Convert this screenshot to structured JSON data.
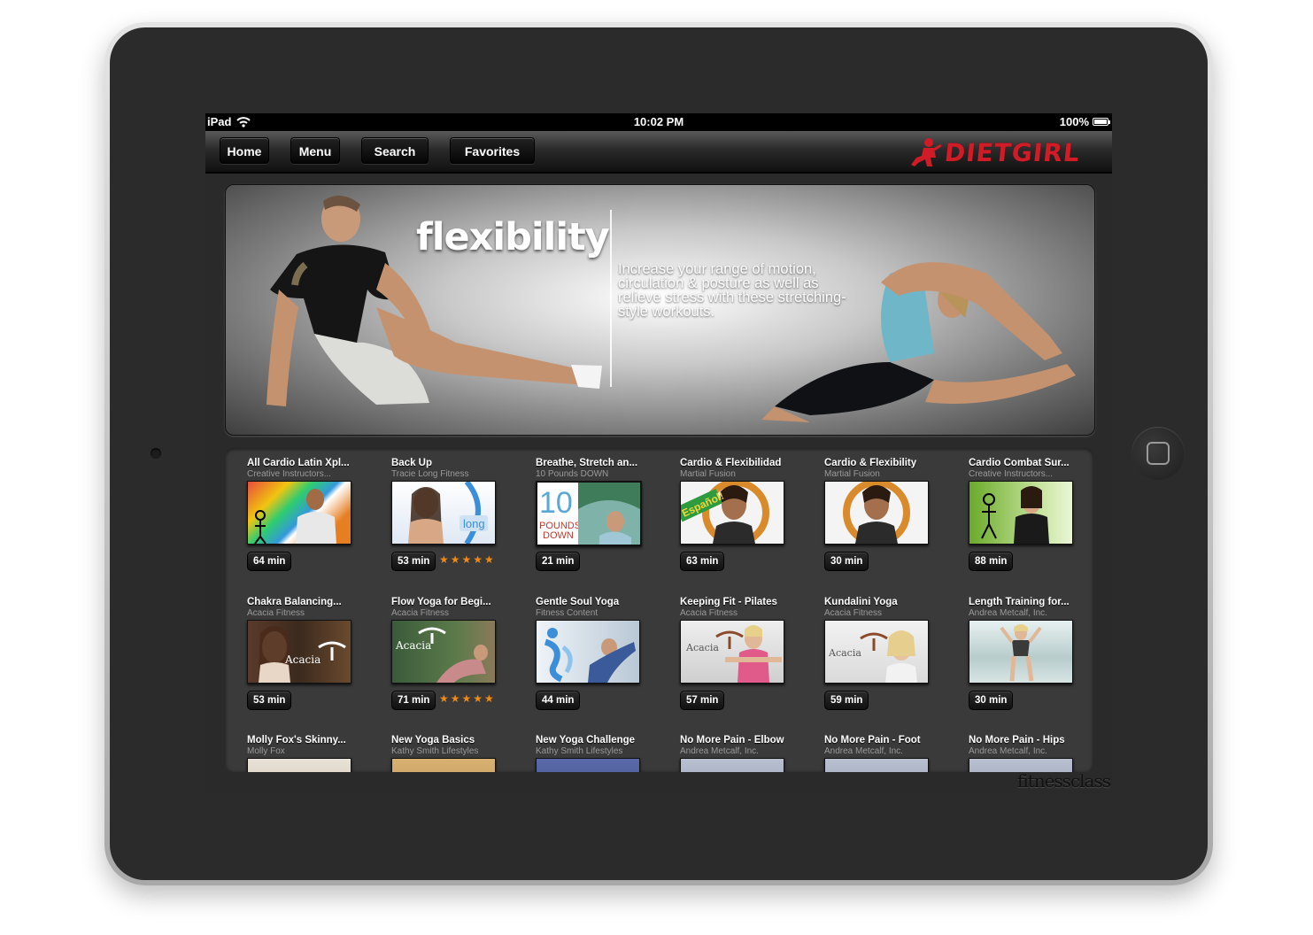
{
  "status_bar": {
    "device": "iPad",
    "time": "10:02 PM",
    "battery": "100%"
  },
  "nav": {
    "buttons": [
      "Home",
      "Menu",
      "Search",
      "Favorites"
    ],
    "logo": "DIETGIRL"
  },
  "hero": {
    "title": "flexibility",
    "description": "Increase your range of motion, circulation & posture as well as relieve stress with these stretching-style workouts."
  },
  "workouts": [
    {
      "title": "All Cardio Latin Xpl...",
      "author": "Creative Instructors...",
      "duration": "64 min",
      "rating": 0
    },
    {
      "title": "Back Up",
      "author": "Tracie Long Fitness",
      "duration": "53 min",
      "rating": 5
    },
    {
      "title": "Breathe, Stretch an...",
      "author": "10 Pounds DOWN",
      "duration": "21 min",
      "rating": 0
    },
    {
      "title": "Cardio & Flexibilidad",
      "author": "Martial Fusion",
      "duration": "63 min",
      "rating": 0
    },
    {
      "title": "Cardio & Flexibility",
      "author": "Martial Fusion",
      "duration": "30 min",
      "rating": 0
    },
    {
      "title": "Cardio Combat Sur...",
      "author": "Creative Instructors...",
      "duration": "88 min",
      "rating": 0
    },
    {
      "title": "Chakra Balancing...",
      "author": "Acacia Fitness",
      "duration": "53 min",
      "rating": 0
    },
    {
      "title": "Flow Yoga for Begi...",
      "author": "Acacia Fitness",
      "duration": "71 min",
      "rating": 5
    },
    {
      "title": "Gentle Soul Yoga",
      "author": "Fitness Content",
      "duration": "44 min",
      "rating": 0
    },
    {
      "title": "Keeping Fit - Pilates",
      "author": "Acacia Fitness",
      "duration": "57 min",
      "rating": 0
    },
    {
      "title": "Kundalini Yoga",
      "author": "Acacia Fitness",
      "duration": "59 min",
      "rating": 0
    },
    {
      "title": "Length Training for...",
      "author": "Andrea Metcalf, Inc.",
      "duration": "30 min",
      "rating": 0
    },
    {
      "title": "Molly Fox's Skinny...",
      "author": "Molly Fox",
      "duration": "",
      "rating": 0
    },
    {
      "title": "New Yoga Basics",
      "author": "Kathy Smith Lifestyles",
      "duration": "",
      "rating": 0
    },
    {
      "title": "New Yoga Challenge",
      "author": "Kathy Smith Lifestyles",
      "duration": "",
      "rating": 0
    },
    {
      "title": "No More Pain - Elbow",
      "author": "Andrea Metcalf, Inc.",
      "duration": "",
      "rating": 0
    },
    {
      "title": "No More Pain - Foot",
      "author": "Andrea Metcalf, Inc.",
      "duration": "",
      "rating": 0
    },
    {
      "title": "No More Pain - Hips",
      "author": "Andrea Metcalf, Inc.",
      "duration": "",
      "rating": 0
    }
  ],
  "thumb_text": {
    "acacia": "Acacia",
    "ten": "10",
    "pounds": "POUNDS",
    "down": "DOWN",
    "espanol": "Español!",
    "long": "long"
  },
  "watermark": "fitnessclass",
  "colors": {
    "logo_red": "#d01c27",
    "star_orange": "#f08a14",
    "screen_bg": "#2a2a2a"
  }
}
